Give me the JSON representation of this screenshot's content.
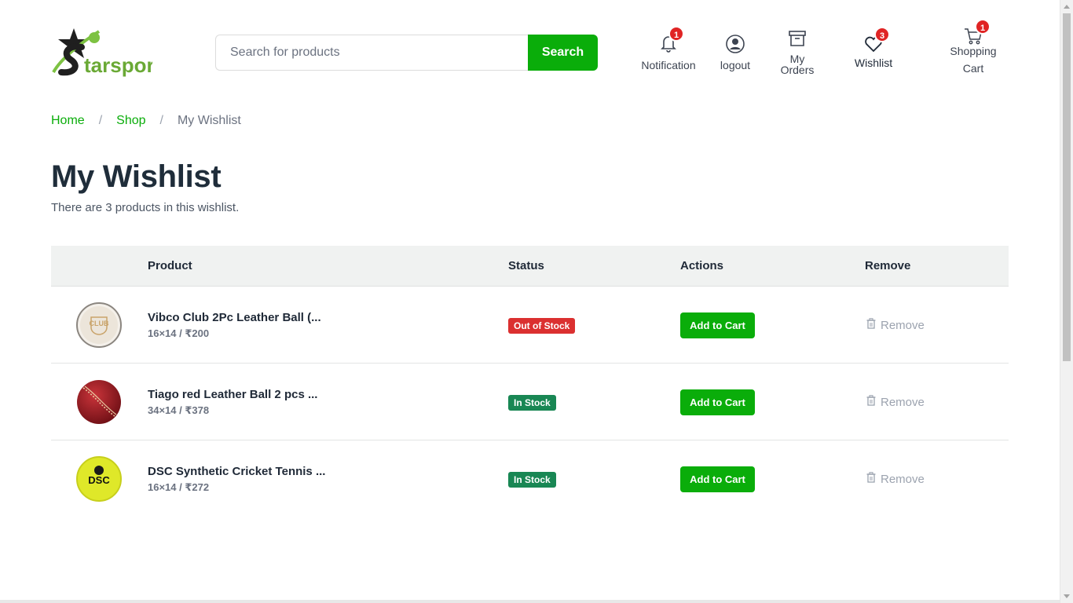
{
  "brand": {
    "logo_text": "tarsport",
    "accent": "#0aad0a"
  },
  "search": {
    "placeholder": "Search for products",
    "button_label": "Search"
  },
  "nav": {
    "notification": {
      "label": "Notification",
      "badge": "1"
    },
    "logout": {
      "label": "logout"
    },
    "orders": {
      "label_line1": "My",
      "label_line2": "Orders"
    },
    "wishlist": {
      "label": "Wishlist",
      "badge": "3"
    },
    "cart": {
      "label_line1": "Shopping",
      "label_line2": "Cart",
      "badge": "1"
    }
  },
  "breadcrumb": {
    "home": "Home",
    "sep": "/",
    "shop": "Shop",
    "current": "My Wishlist"
  },
  "page": {
    "title": "My Wishlist",
    "subtitle": "There are 3 products in this wishlist."
  },
  "table": {
    "headers": {
      "product": "Product",
      "status": "Status",
      "actions": "Actions",
      "remove": "Remove"
    },
    "rows": [
      {
        "name": "Vibco Club 2Pc Leather Ball (...",
        "meta": "16×14 / ₹200",
        "status": "Out of Stock",
        "status_type": "out",
        "action": "Add to Cart",
        "remove": "Remove",
        "image": "white-leather-ball",
        "image_text": "CLUB"
      },
      {
        "name": "Tiago red Leather Ball 2 pcs ...",
        "meta": "34×14 / ₹378",
        "status": "In Stock",
        "status_type": "in",
        "action": "Add to Cart",
        "remove": "Remove",
        "image": "red-leather-ball"
      },
      {
        "name": "DSC Synthetic Cricket Tennis ...",
        "meta": "16×14 / ₹272",
        "status": "In Stock",
        "status_type": "in",
        "action": "Add to Cart",
        "remove": "Remove",
        "image": "yellow-tennis-ball",
        "image_text": "DSC"
      }
    ]
  },
  "colors": {
    "out_of_stock": "#db3030",
    "in_stock": "#198754",
    "badge": "#e02424"
  }
}
